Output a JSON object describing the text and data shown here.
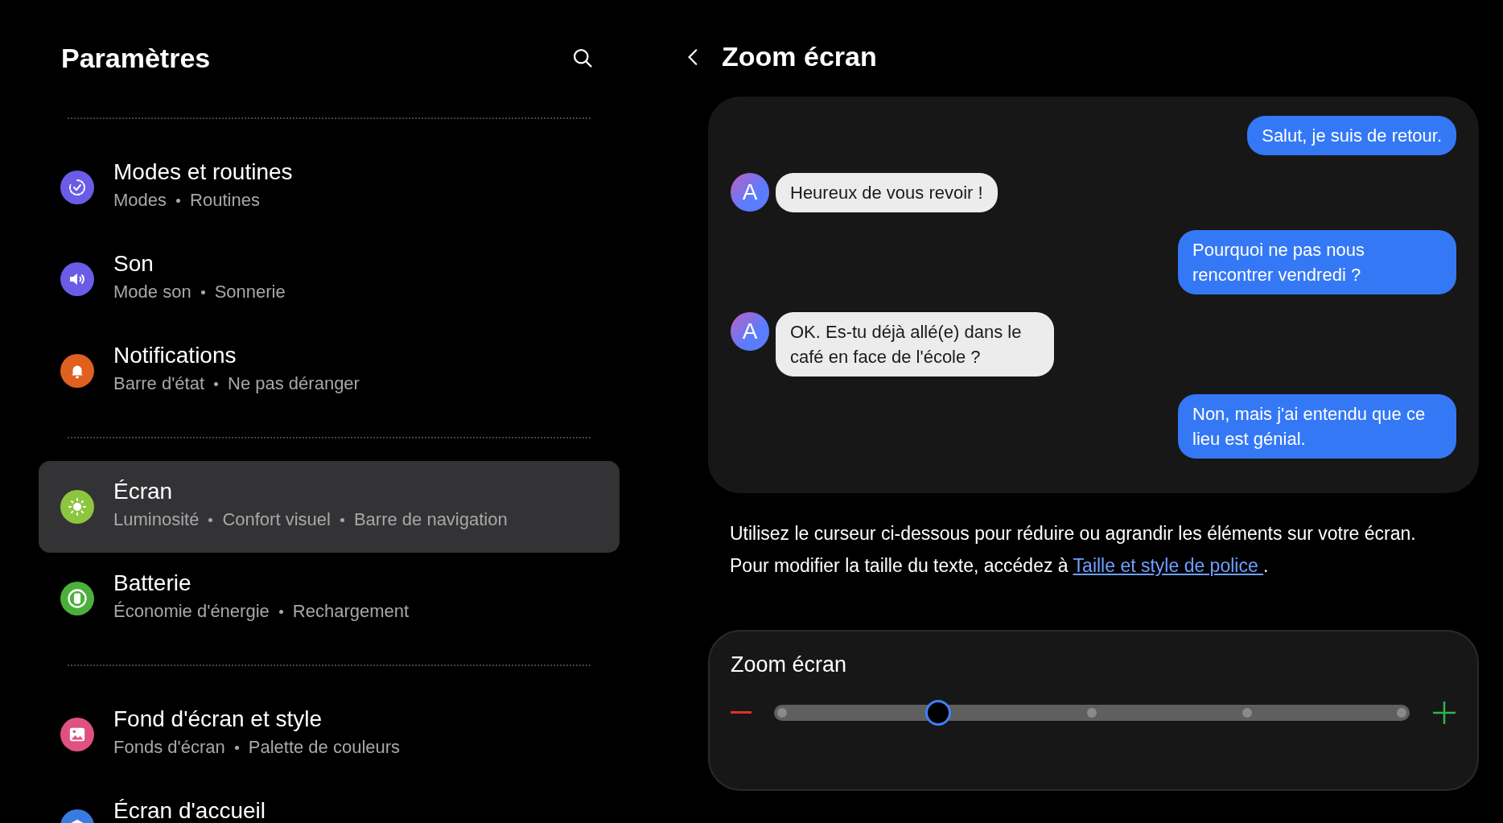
{
  "sidebar": {
    "title": "Paramètres",
    "groups": [
      {
        "items": [
          {
            "title": "Modes et routines",
            "subtitle": [
              "Modes",
              "Routines"
            ],
            "selected": false,
            "color": "#6b5ce7"
          },
          {
            "title": "Son",
            "subtitle": [
              "Mode son",
              "Sonnerie"
            ],
            "selected": false,
            "color": "#6b5ce7"
          },
          {
            "title": "Notifications",
            "subtitle": [
              "Barre d'état",
              "Ne pas déranger"
            ],
            "selected": false,
            "color": "#e0601f"
          }
        ]
      },
      {
        "items": [
          {
            "title": "Écran",
            "subtitle": [
              "Luminosité",
              "Confort visuel",
              "Barre de navigation"
            ],
            "selected": true,
            "color": "#8cc63f"
          },
          {
            "title": "Batterie",
            "subtitle": [
              "Économie d'énergie",
              "Rechargement"
            ],
            "selected": false,
            "color": "#4caf3c"
          }
        ]
      },
      {
        "items": [
          {
            "title": "Fond d'écran et style",
            "subtitle": [
              "Fonds d'écran",
              "Palette de couleurs"
            ],
            "selected": false,
            "color": "#e05080"
          },
          {
            "title": "Écran d'accueil",
            "selected": false,
            "color": "#3a7be0"
          }
        ]
      }
    ]
  },
  "detail": {
    "title": "Zoom écran",
    "messages": [
      {
        "kind": "sent",
        "text": "Salut, je suis de retour."
      },
      {
        "kind": "received",
        "avatar": "A",
        "text": "Heureux de vous revoir !"
      },
      {
        "kind": "sent",
        "text": "Pourquoi ne pas nous rencontrer vendredi ?"
      },
      {
        "kind": "received",
        "avatar": "A",
        "text": "OK. Es-tu déjà allé(e) dans le café en face de l'école ?"
      },
      {
        "kind": "sent",
        "text": "Non, mais j'ai entendu que ce lieu est génial."
      }
    ],
    "description": {
      "text": "Utilisez le curseur ci-dessous pour réduire ou agrandir les éléments sur votre écran. Pour modifier la taille du texte, accédez à ",
      "link": "Taille et style de police ",
      "after": "."
    },
    "slider": {
      "label": "Zoom écran",
      "level": 0.25
    }
  }
}
